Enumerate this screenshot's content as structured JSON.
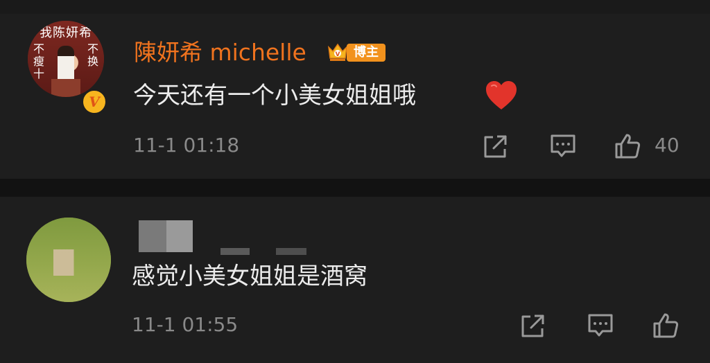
{
  "comments": [
    {
      "username": "陳妍希 michelle",
      "badge_label": "博主",
      "avatar_banner": "我陈妍希",
      "avatar_left_text": "不瘦十",
      "avatar_right_text": "不换",
      "verified_mark": "V",
      "text": "今天还有一个小美女姐姐哦",
      "timestamp": "11-1 01:18",
      "like_count": "40"
    },
    {
      "username": "",
      "text": "感觉小美女姐姐是酒窝",
      "timestamp": "11-1 01:55",
      "like_count": ""
    }
  ],
  "colors": {
    "background": "#1e1e1e",
    "divider": "#121212",
    "username": "#f0731e",
    "badge": "#f2921d",
    "text": "#ececec",
    "meta": "#8a8a8a",
    "heart": "#e2342b"
  },
  "icons": [
    "share-icon",
    "comment-icon",
    "like-icon",
    "heart-icon",
    "crown-icon"
  ]
}
